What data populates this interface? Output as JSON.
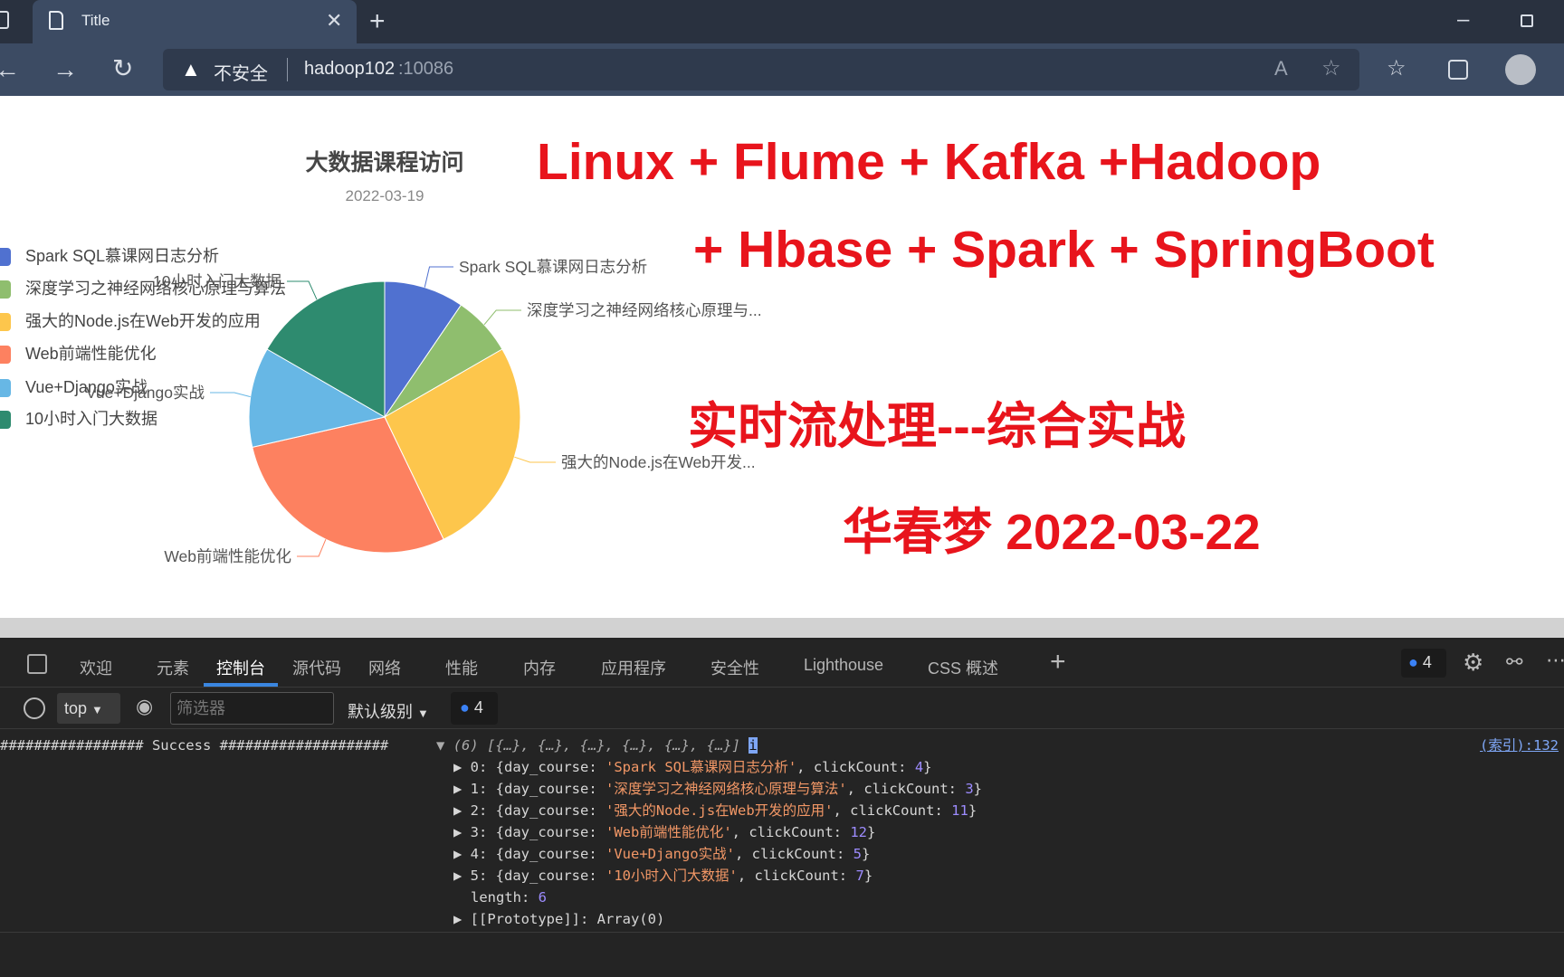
{
  "browser": {
    "tab_title": "Title",
    "security_label": "不安全",
    "url_host": "hadoop102",
    "url_port": ":10086"
  },
  "chart_data": {
    "type": "pie",
    "title": "大数据课程访问",
    "subtitle": "2022-03-19",
    "legend_position": "top-left",
    "categories": [
      "Spark SQL慕课网日志分析",
      "深度学习之神经网络核心原理与算法",
      "强大的Node.js在Web开发的应用",
      "Web前端性能优化",
      "Vue+Django实战",
      "10小时入门大数据"
    ],
    "slice_labels": [
      "Spark SQL慕课网日志分析",
      "深度学习之神经网络核心原理与...",
      "强大的Node.js在Web开发...",
      "Web前端性能优化",
      "Vue+Django实战",
      "10小时入门大数据"
    ],
    "values": [
      4,
      3,
      11,
      12,
      5,
      7
    ],
    "colors": [
      "#5071d0",
      "#8fbe6e",
      "#fdc64c",
      "#fd8160",
      "#67b7e5",
      "#2e8b6f"
    ]
  },
  "overlay": {
    "line1": "Linux + Flume + Kafka +Hadoop",
    "line2": "+ Hbase + Spark + SpringBoot",
    "line3": "实时流处理---综合实战",
    "line4": "华春梦 2022-03-22",
    "color": "#e8141c"
  },
  "devtools": {
    "tabs": [
      "欢迎",
      "元素",
      "控制台",
      "源代码",
      "网络",
      "性能",
      "内存",
      "应用程序",
      "安全性",
      "Lighthouse",
      "CSS 概述"
    ],
    "active_tab": "控制台",
    "issues_count": "4",
    "context": "top",
    "filter_placeholder": "筛选器",
    "level": "默认级别",
    "message_count": "4",
    "log_prefix": "################# Success ####################",
    "array_summary": "(6) [{…}, {…}, {…}, {…}, {…}, {…}]",
    "source_link": "(索引):132",
    "items": [
      {
        "idx": "0",
        "course": "'Spark SQL慕课网日志分析'",
        "count": "4"
      },
      {
        "idx": "1",
        "course": "'深度学习之神经网络核心原理与算法'",
        "count": "3"
      },
      {
        "idx": "2",
        "course": "'强大的Node.js在Web开发的应用'",
        "count": "11"
      },
      {
        "idx": "3",
        "course": "'Web前端性能优化'",
        "count": "12"
      },
      {
        "idx": "4",
        "course": "'Vue+Django实战'",
        "count": "5"
      },
      {
        "idx": "5",
        "course": "'10小时入门大数据'",
        "count": "7"
      }
    ],
    "length_key": "length",
    "length_val": "6",
    "prototype": "[[Prototype]]: Array(0)"
  }
}
